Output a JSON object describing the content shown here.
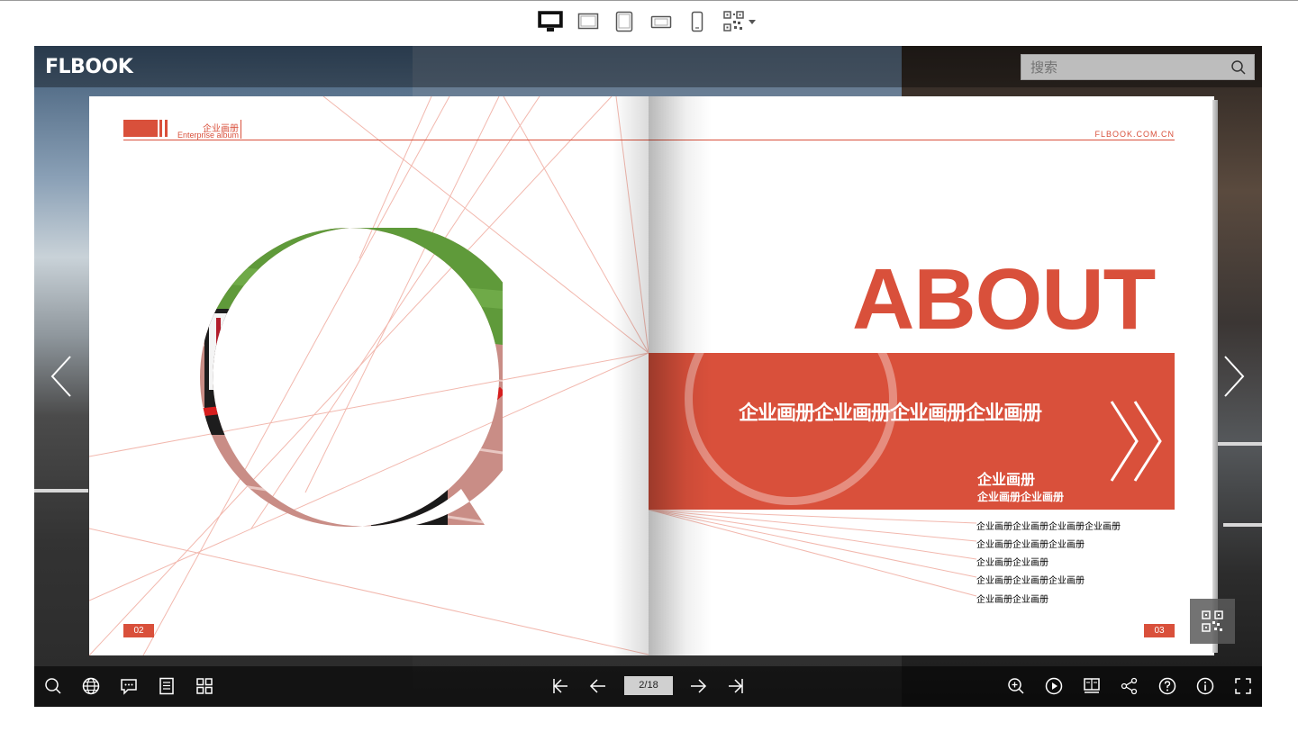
{
  "device_bar": {
    "items": [
      {
        "name": "desktop",
        "active": true
      },
      {
        "name": "tablet-landscape",
        "active": false
      },
      {
        "name": "tablet-portrait",
        "active": false
      },
      {
        "name": "phone-landscape",
        "active": false
      },
      {
        "name": "phone-portrait",
        "active": false
      },
      {
        "name": "qr-code",
        "active": false
      }
    ]
  },
  "header": {
    "logo": "FLBOOK",
    "search_placeholder": "搜索"
  },
  "book": {
    "left_page": {
      "header_cn": "企业画册",
      "header_en": "Enterprise album",
      "page_number": "02"
    },
    "right_page": {
      "site": "FLBOOK.COM.CN",
      "heading": "ABOUT",
      "band_title": "企业画册企业画册企业画册企业画册",
      "band_sub1": "企业画册",
      "band_sub2": "企业画册企业画册",
      "list": [
        "企业画册企业画册企业画册企业画册",
        "企业画册企业画册企业画册",
        "企业画册企业画册",
        "企业画册企业画册企业画册",
        "企业画册企业画册"
      ],
      "page_number": "03"
    }
  },
  "toolbar": {
    "left_icons": [
      "search-icon",
      "globe-icon",
      "comment-icon",
      "document-icon",
      "grid-icon"
    ],
    "center": {
      "page_indicator": "2/18"
    },
    "right_icons": [
      "zoom-in-icon",
      "play-icon",
      "bookmark-icon",
      "share-icon",
      "help-icon",
      "info-icon",
      "fullscreen-icon"
    ]
  },
  "colors": {
    "accent": "#d9503b",
    "toolbar_bg": "#1e1e1e"
  }
}
